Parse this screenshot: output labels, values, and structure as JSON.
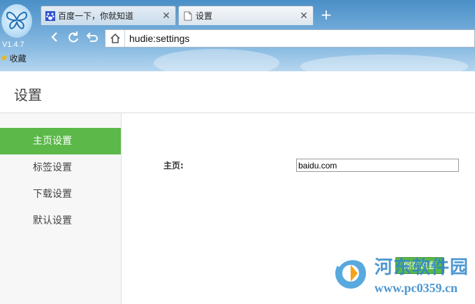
{
  "browser": {
    "version": "V1.4.7",
    "favorites_label": "收藏",
    "tabs": [
      {
        "title": "百度一下，你就知道",
        "icon": "baidu-paw-icon"
      },
      {
        "title": "设置",
        "icon": "page-icon"
      }
    ],
    "new_tab_symbol": "+",
    "address": "hudie:settings"
  },
  "page": {
    "title": "设置",
    "sidebar": [
      {
        "label": "主页设置",
        "active": true
      },
      {
        "label": "标签设置",
        "active": false
      },
      {
        "label": "下载设置",
        "active": false
      },
      {
        "label": "默认设置",
        "active": false
      }
    ],
    "homepage_label": "主页:",
    "homepage_value": "baidu.com",
    "save_label": "保存设置"
  },
  "watermark": {
    "title": "河东软件园",
    "url": "www.pc0359.cn"
  },
  "colors": {
    "accent": "#5bb849",
    "chrome_blue": "#6aa6d6",
    "watermark": "#2f86c9"
  }
}
